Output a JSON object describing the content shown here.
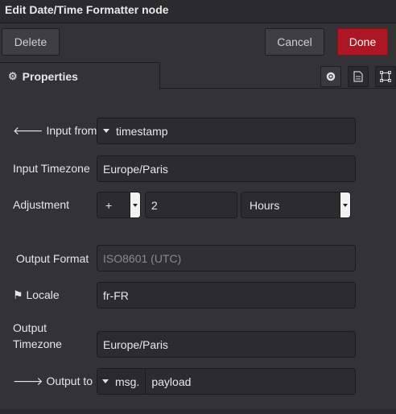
{
  "window": {
    "title": "Edit Date/Time Formatter node"
  },
  "toolbar": {
    "delete_label": "Delete",
    "cancel_label": "Cancel",
    "done_label": "Done"
  },
  "tabs": {
    "properties_label": "Properties",
    "icons": [
      "gear-icon",
      "description-icon",
      "appearance-icon"
    ]
  },
  "form": {
    "input_from": {
      "label": "Input from",
      "icon": "arrow-left-icon",
      "type_value": "",
      "value": "timestamp"
    },
    "input_timezone": {
      "label": "Input Timezone",
      "value": "Europe/Paris"
    },
    "adjustment": {
      "label": "Adjustment",
      "sign": "+",
      "amount": "2",
      "unit": "Hours"
    },
    "output_format": {
      "label": "Output Format",
      "placeholder": "ISO8601 (UTC)"
    },
    "locale": {
      "label": "Locale",
      "icon": "flag-icon",
      "value": "fr-FR"
    },
    "output_timezone": {
      "label_line1": "Output",
      "label_line2": "Timezone",
      "value": "Europe/Paris"
    },
    "output_to": {
      "label": "Output to",
      "icon": "arrow-right-icon",
      "type_value": "msg.",
      "value": "payload"
    }
  },
  "colors": {
    "done": "#ad1625",
    "background": "#333336",
    "field": "#2c2c2f"
  }
}
